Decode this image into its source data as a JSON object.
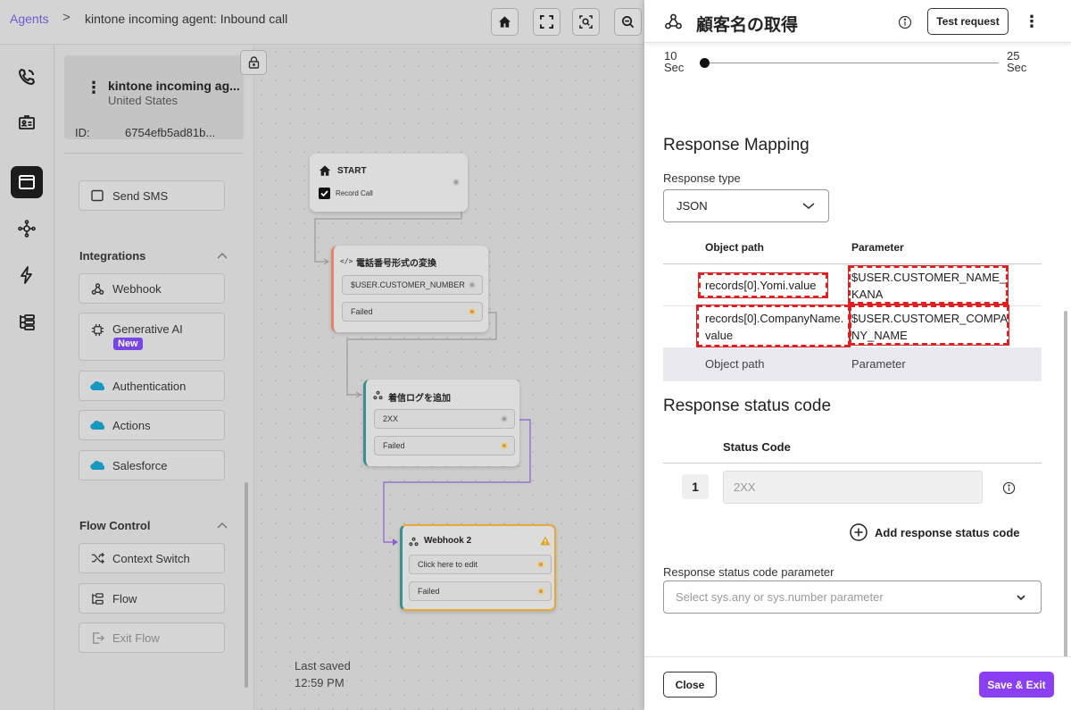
{
  "breadcrumb": {
    "root": "Agents",
    "separator": ">",
    "current": "kintone incoming agent: Inbound call"
  },
  "agent": {
    "name": "kintone incoming ag...",
    "country": "United States",
    "id_label": "ID:",
    "id_value": "6754efb5ad81b..."
  },
  "left_panel": {
    "send_sms": "Send SMS",
    "integrations": {
      "header": "Integrations",
      "items": {
        "webhook": "Webhook",
        "generative_ai": "Generative AI",
        "new_badge": "New",
        "authentication": "Authentication",
        "actions": "Actions",
        "salesforce": "Salesforce"
      }
    },
    "flow_control": {
      "header": "Flow Control",
      "items": {
        "context_switch": "Context Switch",
        "flow": "Flow",
        "exit_flow": "Exit Flow"
      }
    }
  },
  "canvas": {
    "start": {
      "title": "START",
      "checkbox_label": "Record Call"
    },
    "convert": {
      "title": "電話番号形式の変換",
      "row1": "$USER.CUSTOMER_NUMBER",
      "row2": "Failed"
    },
    "log": {
      "title": "着信ログを追加",
      "row1": "2XX",
      "row2": "Failed"
    },
    "webhook2": {
      "title": "Webhook 2",
      "row1": "Click here to edit",
      "row2": "Failed"
    },
    "last_saved_label": "Last saved",
    "last_saved_time": "12:59 PM"
  },
  "drawer": {
    "title": "顧客名の取得",
    "test_request": "Test request",
    "slider": {
      "min_value": "10",
      "min_unit": "Sec",
      "max_value": "25",
      "max_unit": "Sec"
    },
    "response_mapping": {
      "heading": "Response Mapping",
      "response_type_label": "Response type",
      "response_type_value": "JSON",
      "columns": {
        "object_path": "Object path",
        "parameter": "Parameter"
      },
      "rows": [
        {
          "path": "records[0].Yomi.value",
          "param_line1": "$USER.CUSTOMER_NAME_",
          "param_line2": "KANA"
        },
        {
          "path_line1": "records[0].CompanyName.",
          "path_line2": "value",
          "param_line1": "$USER.CUSTOMER_COMPA",
          "param_line2": "NY_NAME"
        }
      ],
      "placeholder_path": "Object path",
      "placeholder_param": "Parameter"
    },
    "status_code": {
      "heading": "Response status code",
      "column": "Status Code",
      "row_number": "1",
      "row_placeholder": "2XX",
      "add_label": "Add response status code",
      "param_label": "Response status code parameter",
      "param_placeholder": "Select sys.any or sys.number parameter"
    },
    "close": "Close",
    "save_exit": "Save & Exit"
  },
  "colors": {
    "accent": "#8b3ff2",
    "link": "#6d5bd0",
    "highlight_box": "#e02020",
    "webhook_node_border": "#e5a83a",
    "convert_node_bar": "#e4826d"
  }
}
